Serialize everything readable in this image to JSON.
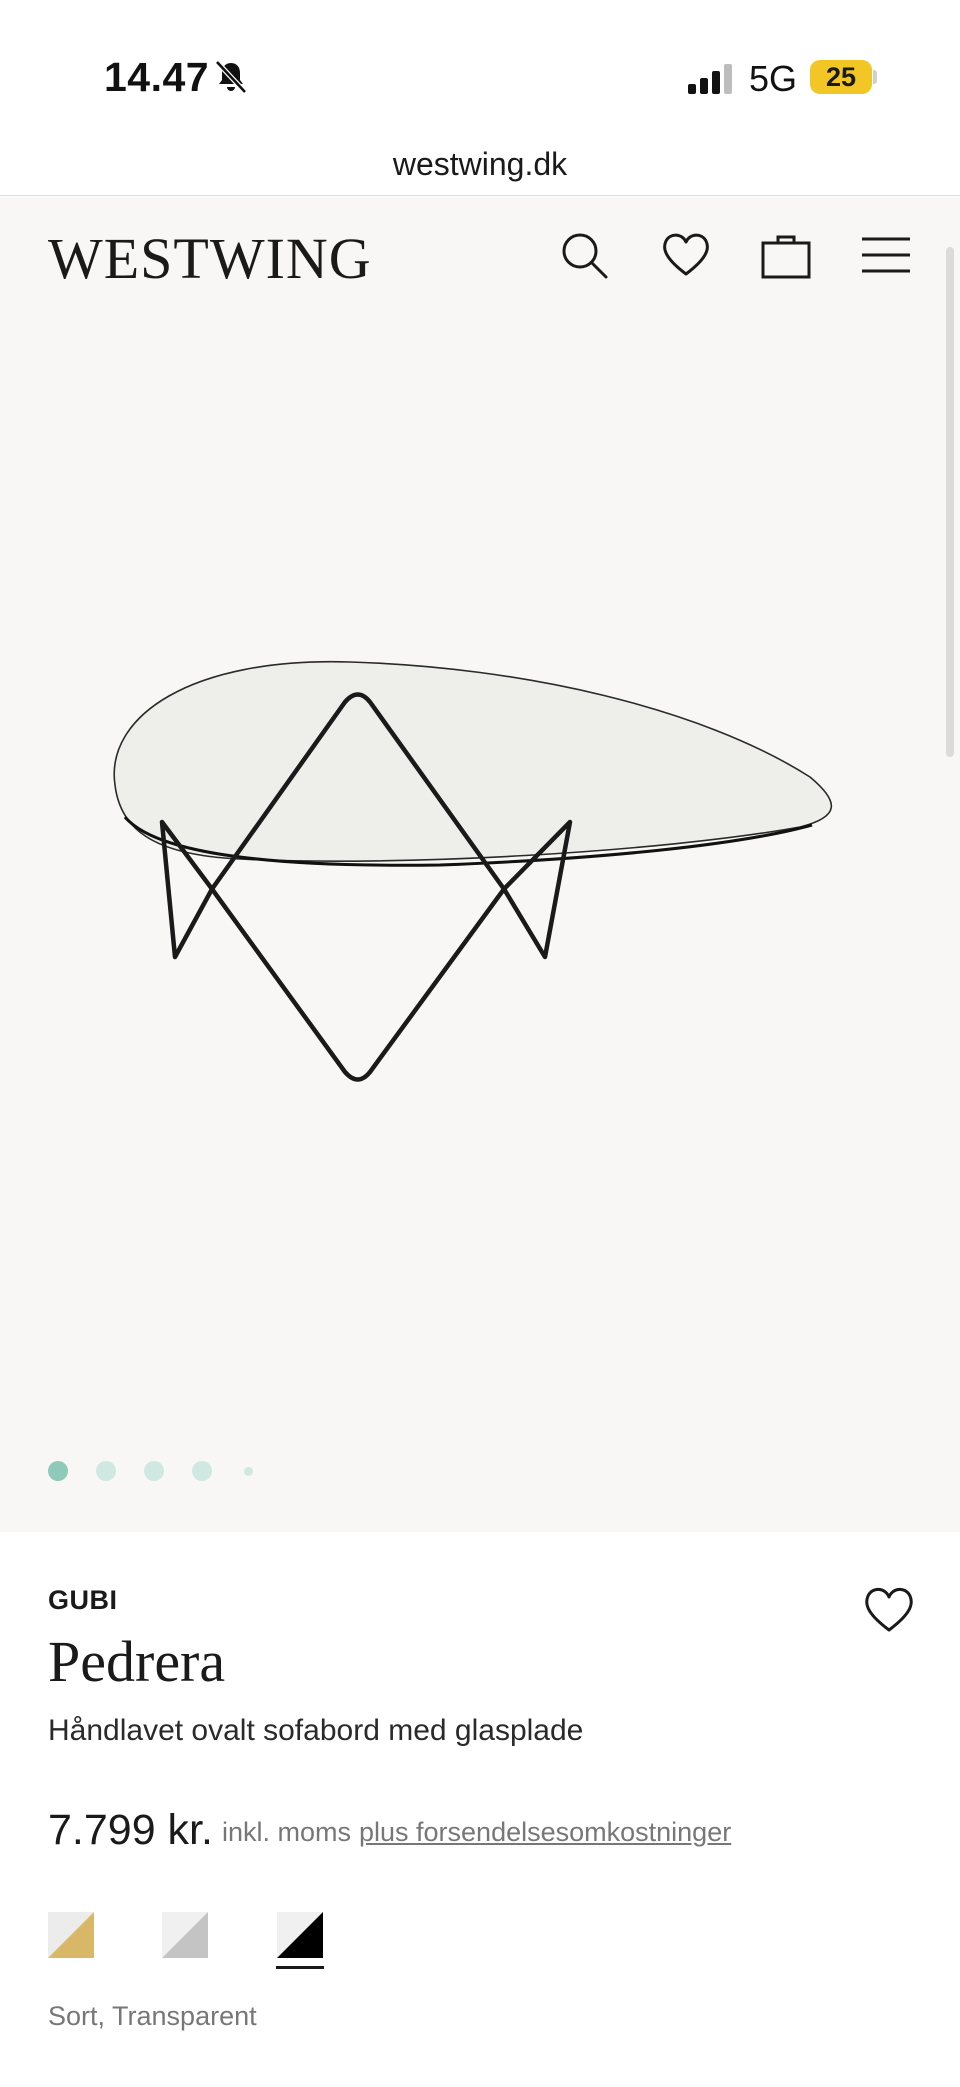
{
  "status_bar": {
    "time": "14.47",
    "network": "5G",
    "battery": "25"
  },
  "browser": {
    "url": "westwing.dk"
  },
  "header": {
    "logo": "WESTWING",
    "icons": [
      "search-icon",
      "heart-icon",
      "bag-icon",
      "menu-icon"
    ]
  },
  "gallery": {
    "image_count": 5,
    "active_index": 0
  },
  "product": {
    "brand": "GUBI",
    "name": "Pedrera",
    "description": "Håndlavet ovalt sofabord med glasplade",
    "price": "7.799 kr.",
    "vat_note": "inkl. moms",
    "shipping_link": "plus forsendelsesomkostninger",
    "selected_variant": "Sort, Transparent",
    "swatches": [
      {
        "name": "gold",
        "color": "#d8b867"
      },
      {
        "name": "silver",
        "color": "#cfcfcf"
      },
      {
        "name": "black",
        "color": "#000000",
        "selected": true
      }
    ]
  },
  "colors": {
    "dot_active": "#8fc9b9",
    "dot_inactive": "#cfe8e1",
    "gallery_bg": "#f8f7f5",
    "battery": "#f2c624"
  }
}
